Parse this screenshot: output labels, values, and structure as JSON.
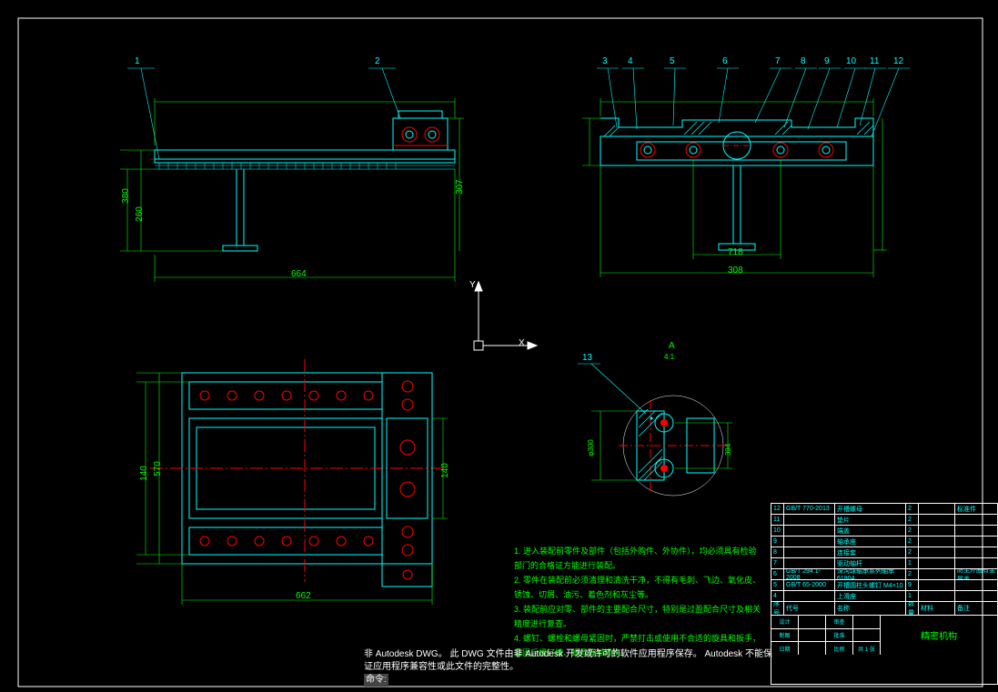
{
  "balloons": {
    "top_left": [
      "1",
      "2"
    ],
    "top_right": [
      "3",
      "4",
      "5",
      "6",
      "7",
      "8",
      "9",
      "10",
      "11",
      "12"
    ],
    "detail": "13"
  },
  "axes": {
    "x": "X",
    "y": "Y"
  },
  "dim_left_a": "380",
  "dim_left_b": "260",
  "dim_left_c": "307",
  "dim_left_bottom": "664",
  "dim_right_bottom": "308",
  "dim_right_mid": "718",
  "dim_plan_h": "570",
  "dim_plan_w": "140",
  "dim_plan_bottom": "662",
  "dim_plan_right": "140",
  "detail_label_a": "A",
  "detail_label_b": "4:1",
  "detail_dim": "φ300",
  "detail_dim2": "394",
  "notes": {
    "n1": "1. 进入装配前零件及部件（包括外购件、外协件），均必须具有检验部门的合格证方能进行装配。",
    "n2": "2. 零件在装配前必须清理和清洗干净，不得有毛刺、飞边、氧化皮、锈蚀、切屑、油污、着色剂和灰尘等。",
    "n3": "3. 装配前应对零、部件的主要配合尺寸，特别是过盈配合尺寸及相关精度进行复查。",
    "n4": "4. 螺钉、螺栓和螺母紧固时，严禁打击或使用不合适的旋具和扳手，紧固后螺钉槽、螺母等部损伤。"
  },
  "watermark1": "非 Autodesk DWG。  此 DWG  文件由非 Autodesk 开发或许可的软件应用程序保存。  Autodesk 不能保证应用程序兼容性或此文件的完整性。",
  "cmd_prompt": "命令:",
  "titleblock": {
    "rows": [
      {
        "n": "12",
        "std": "GB/T 770-2013",
        "name": "开槽螺母",
        "q": "2",
        "mat": "",
        "rem": "标准件"
      },
      {
        "n": "11",
        "std": "",
        "name": "垫片",
        "q": "2",
        "mat": "",
        "rem": ""
      },
      {
        "n": "10",
        "std": "",
        "name": "端盖",
        "q": "2",
        "mat": "",
        "rem": ""
      },
      {
        "n": "9",
        "std": "",
        "name": "轴承座",
        "q": "2",
        "mat": "",
        "rem": ""
      },
      {
        "n": "8",
        "std": "",
        "name": "连接套",
        "q": "2",
        "mat": "",
        "rem": ""
      },
      {
        "n": "7",
        "std": "",
        "name": "驱动轴杆",
        "q": "1",
        "mat": "",
        "rem": ""
      },
      {
        "n": "6",
        "std": "GB/T 294.1-2008",
        "name": "深沟球轴承系列轴承 61804",
        "q": "2",
        "mat": "",
        "rem": "防主外圈有金属盖"
      },
      {
        "n": "5",
        "std": "GB/T 65-2000",
        "name": "开槽圆柱头螺钉 M4×10",
        "q": "9",
        "mat": "",
        "rem": ""
      },
      {
        "n": "4",
        "std": "",
        "name": "上滑座",
        "q": "1",
        "mat": "",
        "rem": ""
      }
    ],
    "hdr": {
      "no": "序号",
      "code": "代号",
      "name": "名称",
      "qty": "数量",
      "mat": "材料",
      "rem": "备注"
    },
    "footer": {
      "design": "设计",
      "check": "审查",
      "draw": "制图",
      "appr": "批准",
      "date": "日期",
      "scale": "比例",
      "sheet": "共 1 张",
      "title": "精密机构"
    }
  }
}
